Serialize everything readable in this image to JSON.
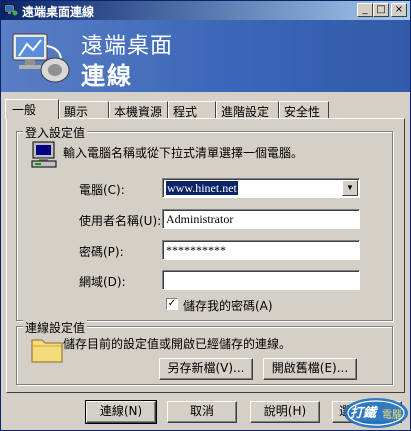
{
  "window": {
    "title": "遠端桌面連線",
    "minimize": "_",
    "maximize": "□",
    "close": "×"
  },
  "banner": {
    "line1": "遠端桌面",
    "line2": "連線"
  },
  "tabs": [
    {
      "label": "一般",
      "active": true
    },
    {
      "label": "顯示"
    },
    {
      "label": "本機資源"
    },
    {
      "label": "程式"
    },
    {
      "label": "進階設定"
    },
    {
      "label": "安全性"
    }
  ],
  "login": {
    "title": "登入設定值",
    "description": "輸入電腦名稱或從下拉式清單選擇一個電腦。",
    "computer_label": "電腦(C):",
    "computer_value": "www.hinet.net",
    "username_label": "使用者名稱(U):",
    "username_value": "Administrator",
    "password_label": "密碼(P):",
    "password_value": "**********",
    "domain_label": "網域(D):",
    "domain_value": "",
    "save_password_label": "儲存我的密碼(A)",
    "save_password_checked": true
  },
  "connection": {
    "title": "連線設定值",
    "description": "儲存目前的設定值或開啟已經儲存的連線。",
    "save_as_label": "另存新檔(V)...",
    "open_label": "開啟舊檔(E)..."
  },
  "buttons": {
    "connect": "連線(N)",
    "cancel": "取消",
    "help": "說明(H)",
    "options": "選"
  },
  "watermark": {
    "text1": "打鐵",
    "text2": "電腦"
  }
}
